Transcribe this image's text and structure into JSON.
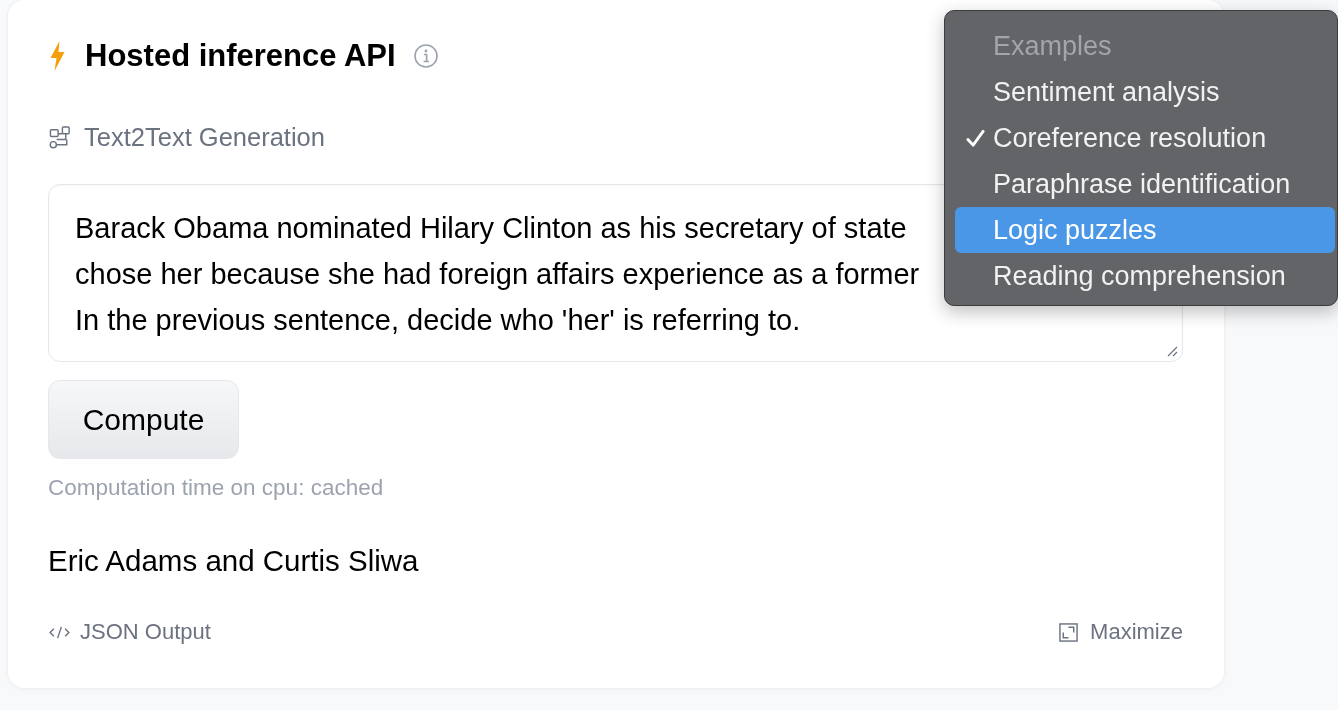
{
  "header": {
    "title": "Hosted inference API"
  },
  "task": {
    "label": "Text2Text Generation"
  },
  "input": {
    "lines": [
      "Barack Obama nominated Hilary Clinton as his secretary of state",
      "chose her because she had foreign affairs experience as a former",
      "In the previous sentence, decide who 'her' is referring to."
    ]
  },
  "compute_button": {
    "label": "Compute"
  },
  "computation_time": "Computation time on cpu: cached",
  "output": {
    "text": "Eric Adams and Curtis Sliwa"
  },
  "footer": {
    "json_output": "JSON Output",
    "maximize": "Maximize"
  },
  "examples_menu": {
    "heading": "Examples",
    "items": [
      {
        "label": "Sentiment analysis",
        "checked": false,
        "selected": false
      },
      {
        "label": "Coreference resolution",
        "checked": true,
        "selected": false
      },
      {
        "label": "Paraphrase identification",
        "checked": false,
        "selected": false
      },
      {
        "label": "Logic puzzles",
        "checked": false,
        "selected": true
      },
      {
        "label": "Reading comprehension",
        "checked": false,
        "selected": false
      }
    ]
  }
}
